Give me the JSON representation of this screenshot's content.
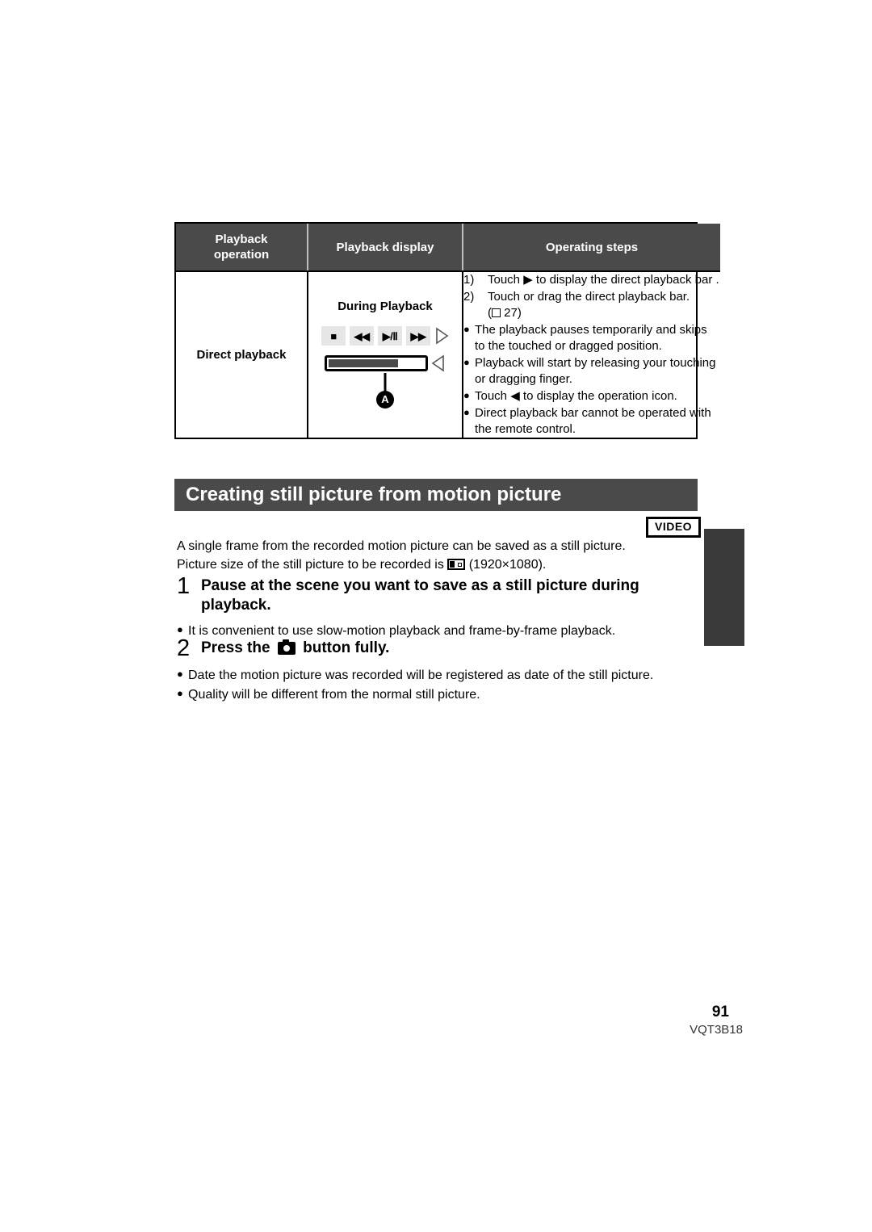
{
  "table": {
    "headers": [
      "Playback\noperation",
      "Playback display",
      "Operating steps"
    ],
    "header_op_line1": "Playback",
    "header_op_line2": "operation",
    "header_display": "Playback display",
    "header_steps": "Operating steps",
    "row": {
      "operation_label": "Direct playback",
      "display": {
        "title": "During Playback",
        "buttons": [
          "stop-icon",
          "rewind-icon",
          "play-pause-icon",
          "fast-forward-icon"
        ],
        "button_glyphs": [
          "■",
          "◀◀",
          "▶/Ⅱ",
          "▶▶"
        ],
        "right_triangle": "triangle-right-outline-icon",
        "left_triangle": "triangle-left-outline-icon",
        "progress_percent": 73,
        "callout_label": "A"
      },
      "steps": {
        "numbered": [
          {
            "num": "1)",
            "text": "Touch ▶ to display the direct playback bar        ."
          },
          {
            "num": "2)",
            "text": "Touch or drag the direct playback bar."
          }
        ],
        "step2_reference": "27",
        "bullets": [
          "The playback pauses temporarily and skips to the touched or dragged position.",
          "Playback will start by releasing your touching or dragging finger.",
          "Touch ◀ to display the operation icon.",
          "Direct playback bar cannot be operated with the remote control."
        ]
      }
    }
  },
  "section": {
    "heading": "Creating still picture from motion picture",
    "badge": "VIDEO"
  },
  "intro": {
    "line1": "A single frame from the recorded motion picture can be saved as a still picture.",
    "line2_before": "Picture size of the still picture to be recorded is",
    "line2_after": "(1920×1080)."
  },
  "steps": [
    {
      "number": "1",
      "title": "Pause at the scene you want to save as a still picture during playback.",
      "bullets": [
        "It is convenient to use slow-motion playback and frame-by-frame playback."
      ]
    },
    {
      "number": "2",
      "title_before": "Press the",
      "title_after": "button fully.",
      "bullets": [
        "Date the motion picture was recorded will be registered as date of the still picture.",
        "Quality will be different from the normal still picture."
      ]
    }
  ],
  "footer": {
    "page_number": "91",
    "doc_code": "VQT3B18"
  },
  "colors": {
    "header_gray": "#4a4a4a",
    "tab_gray": "#3a3a3a",
    "button_gray": "#e6e6e6"
  }
}
